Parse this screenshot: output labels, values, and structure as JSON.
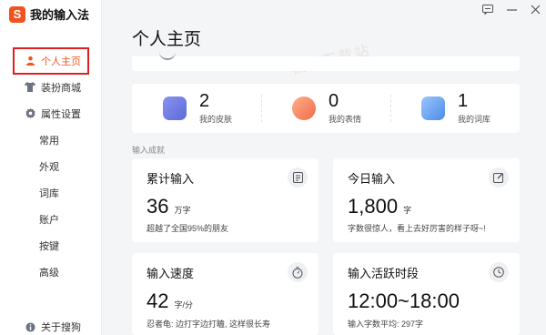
{
  "app": {
    "title": "我的输入法",
    "logo_letter": "S"
  },
  "window_controls": [
    "feedback-icon",
    "minimize-icon",
    "close-icon"
  ],
  "sidebar": {
    "items": [
      {
        "label": "个人主页",
        "icon": "person-icon",
        "active": true
      },
      {
        "label": "装扮商城",
        "icon": "shirt-icon"
      },
      {
        "label": "属性设置",
        "icon": "gear-icon"
      },
      {
        "label": "常用"
      },
      {
        "label": "外观"
      },
      {
        "label": "词库"
      },
      {
        "label": "账户"
      },
      {
        "label": "按键"
      },
      {
        "label": "高级"
      }
    ],
    "footer": {
      "label": "关于搜狗",
      "icon": "info-icon"
    }
  },
  "page": {
    "title": "个人主页",
    "watermark": "极速下载站"
  },
  "stats": [
    {
      "value": "2",
      "label": "我的皮肤",
      "icon": "skin-icon",
      "color": "#5b6ad8"
    },
    {
      "value": "0",
      "label": "我的表情",
      "icon": "emoji-icon",
      "color": "#f06a4a"
    },
    {
      "value": "1",
      "label": "我的词库",
      "icon": "dictionary-icon",
      "color": "#4a8de8"
    }
  ],
  "section_label": "输入成就",
  "cards": {
    "total": {
      "title": "累计输入",
      "value": "36",
      "unit": "万字",
      "note": "超越了全国95%的朋友"
    },
    "today": {
      "title": "今日输入",
      "value": "1,800",
      "unit": "字",
      "note": "字数很惊人，看上去好厉害的样子呀~!"
    },
    "speed": {
      "title": "输入速度",
      "value": "42",
      "unit": "字/分",
      "note": "忍者龟: 边打字边打瞌, 这样很长寿"
    },
    "active": {
      "title": "输入活跃时段",
      "value": "12:00~18:00",
      "note": "输入字数平均: 297字"
    }
  }
}
